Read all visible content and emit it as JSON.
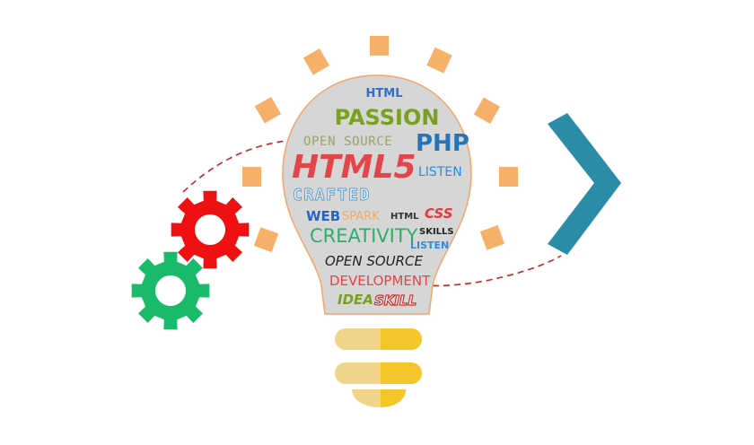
{
  "illustration": {
    "words": {
      "html_top": "HTML",
      "passion": "PASSION",
      "open_source_1": "OPEN SOURCE",
      "php": "PHP",
      "html5": "HTML5",
      "listen_1": "LISTEN",
      "crafted": "CRAFTED",
      "web": "WEB",
      "spark": "SPARK",
      "html_small": "HTML",
      "css": "CSS",
      "creativity": "CREATIVITY",
      "skills": "SKILLS",
      "listen_2": "LISTEN",
      "open_source_2": "OPEN SOURCE",
      "development": "DEVELOPMENT",
      "idea": "IDEA",
      "skill": "SKILL"
    },
    "icons": [
      "gear-icon",
      "gear-icon",
      "chevron-right-icon",
      "lightbulb-icon"
    ],
    "colors": {
      "bulb_fill": "#d6d6d6",
      "bulb_outline": "#f2a46a",
      "rays": "#f6b06a",
      "gear_red": "#ee1111",
      "gear_green": "#19bb6a",
      "chevron": "#2b8ca8",
      "base_light": "#efd48a",
      "base_dark": "#f4c62a",
      "dashed_line": "#cc2222"
    }
  }
}
